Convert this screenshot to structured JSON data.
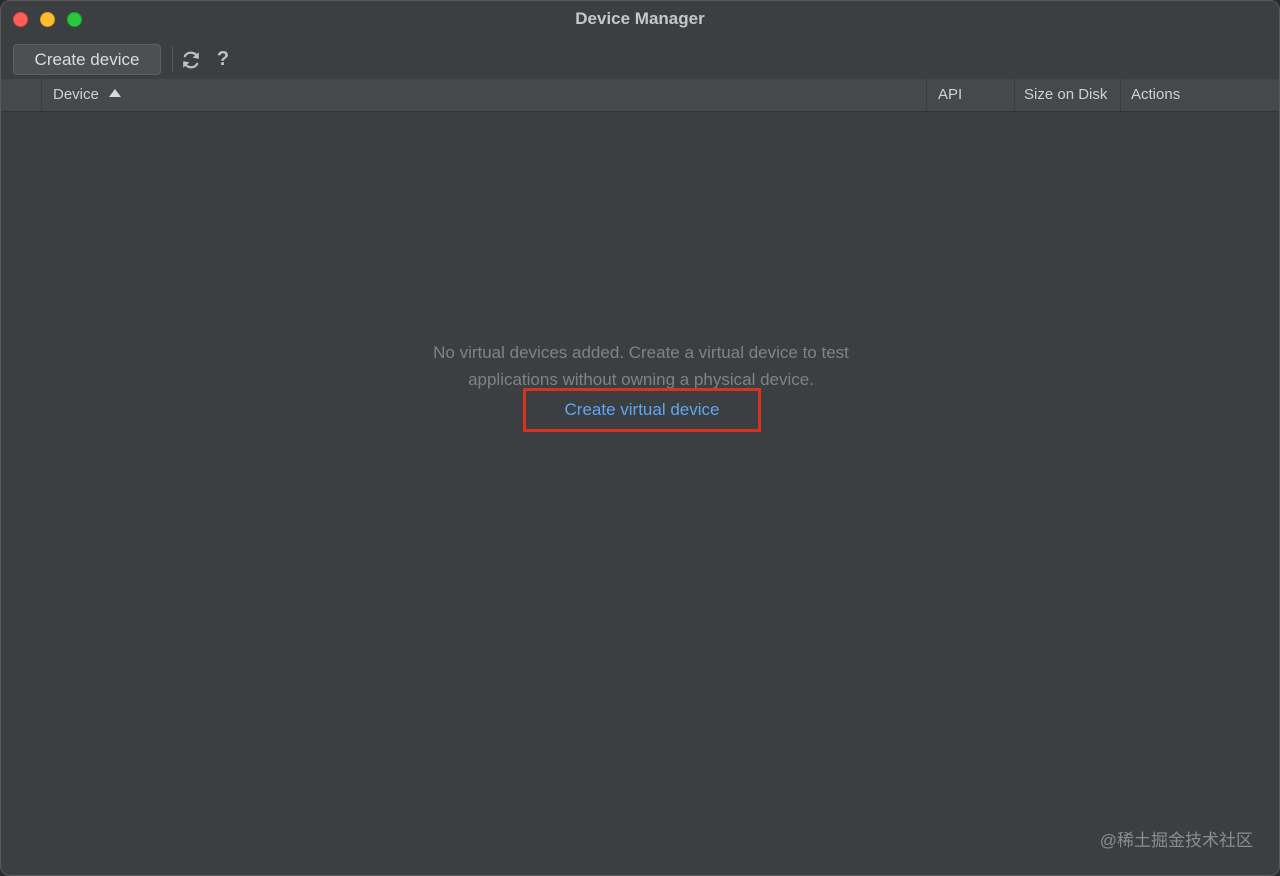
{
  "window": {
    "title": "Device Manager"
  },
  "toolbar": {
    "create_device_label": "Create device",
    "refresh_icon": "refresh-icon",
    "help_label": "?"
  },
  "table": {
    "columns": [
      {
        "label": "Device",
        "sorted": "ascending"
      },
      {
        "label": "API"
      },
      {
        "label": "Size on Disk"
      },
      {
        "label": "Actions"
      }
    ]
  },
  "empty_state": {
    "message_line1": "No virtual devices added. Create a virtual device to test",
    "message_line2": "applications without owning a physical device.",
    "link_label": "Create virtual device"
  },
  "watermark": "@稀土掘金技术社区",
  "colors": {
    "link": "#5ea6f5",
    "highlight_box": "#d53220",
    "traffic_close": "#fe5f57",
    "traffic_minimize": "#febc2e",
    "traffic_maximize": "#28c840"
  }
}
